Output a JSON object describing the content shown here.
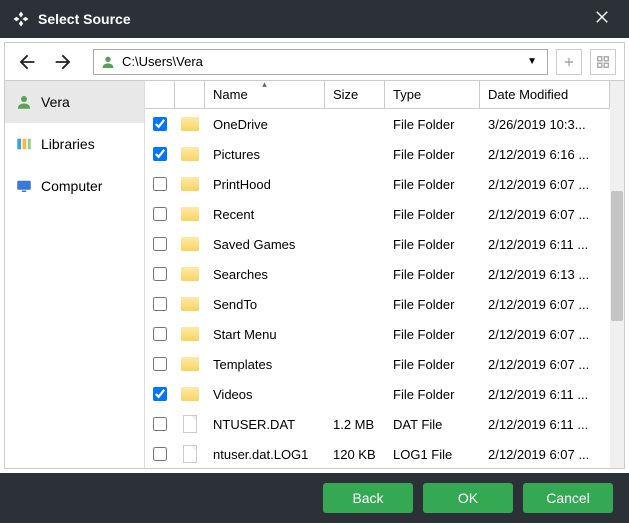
{
  "titlebar": {
    "title": "Select Source"
  },
  "toolbar": {
    "path": "C:\\Users\\Vera"
  },
  "sidebar": {
    "items": [
      {
        "label": "Vera",
        "icon": "user",
        "active": true
      },
      {
        "label": "Libraries",
        "icon": "libraries",
        "active": false
      },
      {
        "label": "Computer",
        "icon": "computer",
        "active": false
      }
    ]
  },
  "columns": {
    "name": "Name",
    "size": "Size",
    "type": "Type",
    "date": "Date Modified"
  },
  "rows": [
    {
      "checked": true,
      "icon": "folder",
      "name": "OneDrive",
      "size": "",
      "type": "File Folder",
      "date": "3/26/2019 10:3..."
    },
    {
      "checked": true,
      "icon": "folder",
      "name": "Pictures",
      "size": "",
      "type": "File Folder",
      "date": "2/12/2019 6:16 ..."
    },
    {
      "checked": false,
      "icon": "folder",
      "name": "PrintHood",
      "size": "",
      "type": "File Folder",
      "date": "2/12/2019 6:07 ..."
    },
    {
      "checked": false,
      "icon": "folder",
      "name": "Recent",
      "size": "",
      "type": "File Folder",
      "date": "2/12/2019 6:07 ..."
    },
    {
      "checked": false,
      "icon": "folder",
      "name": "Saved Games",
      "size": "",
      "type": "File Folder",
      "date": "2/12/2019 6:11 ..."
    },
    {
      "checked": false,
      "icon": "folder",
      "name": "Searches",
      "size": "",
      "type": "File Folder",
      "date": "2/12/2019 6:13 ..."
    },
    {
      "checked": false,
      "icon": "folder",
      "name": "SendTo",
      "size": "",
      "type": "File Folder",
      "date": "2/12/2019 6:07 ..."
    },
    {
      "checked": false,
      "icon": "folder",
      "name": "Start Menu",
      "size": "",
      "type": "File Folder",
      "date": "2/12/2019 6:07 ..."
    },
    {
      "checked": false,
      "icon": "folder",
      "name": "Templates",
      "size": "",
      "type": "File Folder",
      "date": "2/12/2019 6:07 ..."
    },
    {
      "checked": true,
      "icon": "folder",
      "name": "Videos",
      "size": "",
      "type": "File Folder",
      "date": "2/12/2019 6:11 ..."
    },
    {
      "checked": false,
      "icon": "file",
      "name": "NTUSER.DAT",
      "size": "1.2 MB",
      "type": "DAT File",
      "date": "2/12/2019 6:11 ..."
    },
    {
      "checked": false,
      "icon": "file",
      "name": "ntuser.dat.LOG1",
      "size": "120 KB",
      "type": "LOG1 File",
      "date": "2/12/2019 6:07 ..."
    }
  ],
  "footer": {
    "back": "Back",
    "ok": "OK",
    "cancel": "Cancel"
  }
}
